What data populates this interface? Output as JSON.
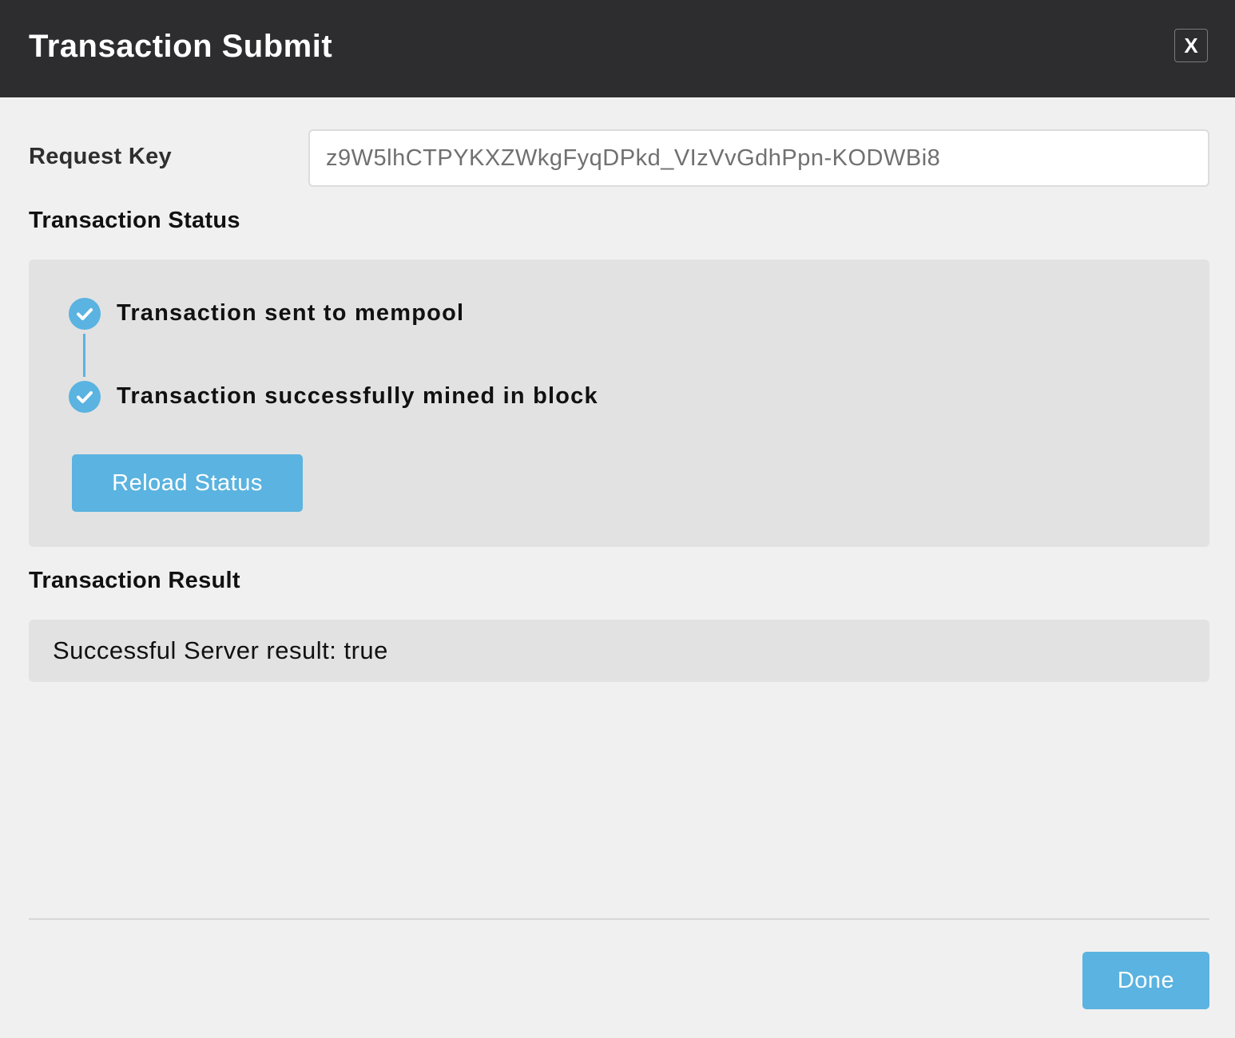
{
  "dialog": {
    "title": "Transaction Submit",
    "close_label": "X"
  },
  "request_key": {
    "label": "Request Key",
    "value": "z9W5lhCTPYKXZWkgFyqDPkd_VIzVvGdhPpn-KODWBi8"
  },
  "status": {
    "heading": "Transaction Status",
    "steps": [
      {
        "label": "Transaction sent to mempool",
        "icon": "check-circle-icon",
        "done": true
      },
      {
        "label": "Transaction successfully mined in block",
        "icon": "check-circle-icon",
        "done": true
      }
    ],
    "reload_label": "Reload Status"
  },
  "result": {
    "heading": "Transaction Result",
    "text": "Successful Server result: true"
  },
  "footer": {
    "done_label": "Done"
  },
  "colors": {
    "header_bg": "#2d2d2f",
    "accent": "#5ab3e0",
    "panel_bg": "#e2e2e2",
    "page_bg": "#f0f0f0"
  }
}
